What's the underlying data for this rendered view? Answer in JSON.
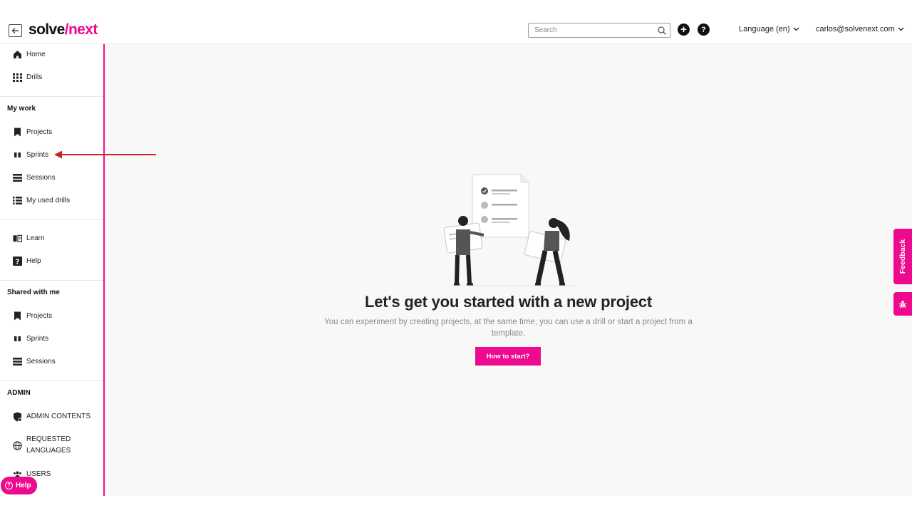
{
  "header": {
    "logo_part1": "solve",
    "logo_slash": "/",
    "logo_part2": "next",
    "search_placeholder": "Search",
    "language_label": "Language (en)",
    "account_email": "carlos@solvenext.com",
    "add_symbol": "+",
    "help_symbol": "?"
  },
  "sidebar": {
    "top_items": [
      {
        "label": "Home",
        "icon": "home-icon"
      },
      {
        "label": "Drills",
        "icon": "grid-icon"
      }
    ],
    "my_work_title": "My work",
    "my_work_items": [
      {
        "label": "Projects",
        "icon": "bookmark-icon"
      },
      {
        "label": "Sprints",
        "icon": "columns-icon"
      },
      {
        "label": "Sessions",
        "icon": "list-icon"
      },
      {
        "label": "My used drills",
        "icon": "list-bullets-icon"
      }
    ],
    "learn_items": [
      {
        "label": "Learn",
        "icon": "book-icon"
      },
      {
        "label": "Help",
        "icon": "question-icon"
      }
    ],
    "shared_title": "Shared with me",
    "shared_items": [
      {
        "label": "Projects",
        "icon": "bookmark-icon"
      },
      {
        "label": "Sprints",
        "icon": "columns-icon"
      },
      {
        "label": "Sessions",
        "icon": "list-icon"
      }
    ],
    "admin_title": "ADMIN",
    "admin_items": [
      {
        "label": "ADMIN CONTENTS",
        "icon": "shield-icon"
      },
      {
        "label_line1": "REQUESTED",
        "label_line2": "LANGUAGES",
        "icon": "globe-icon"
      },
      {
        "label": "USERS",
        "icon": "users-icon"
      }
    ],
    "help_pill_label": "Help"
  },
  "main": {
    "title": "Let's get you started with a new project",
    "subtitle": "You can experiment by creating projects, at the same time, you can use a drill or start a project from a template.",
    "cta_label": "How to start?"
  },
  "feedback": {
    "label": "Feedback"
  },
  "colors": {
    "accent": "#ee0a8e",
    "annotation": "#d41f26",
    "background": "#f8f8f8"
  }
}
